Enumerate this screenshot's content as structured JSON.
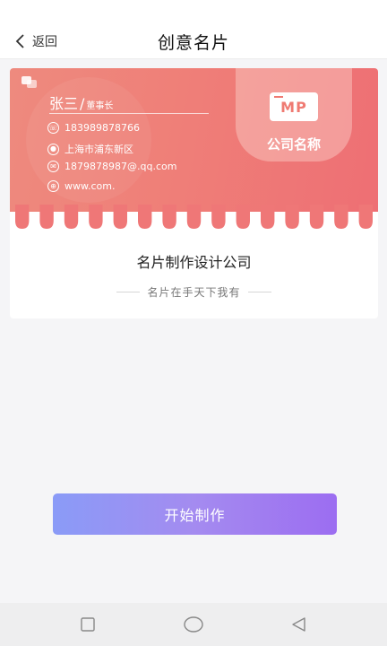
{
  "header": {
    "back_label": "返回",
    "title": "创意名片"
  },
  "card": {
    "logo_text": "MP",
    "company_short": "公司名称",
    "person_name": "张三",
    "person_title": "董事长",
    "phone": "183989878766",
    "address": "上海市浦东新区",
    "email": "1879878987@.qq.com",
    "website": "www.com.",
    "accent_color": "#ef7a72"
  },
  "template": {
    "company_full": "名片制作设计公司",
    "slogan": "名片在手天下我有"
  },
  "action": {
    "start_label": "开始制作"
  },
  "icons": {
    "back": "chevron-left-icon",
    "phone": "phone-icon",
    "location": "location-pin-icon",
    "email": "email-icon",
    "web": "globe-icon",
    "nav_recent": "square-icon",
    "nav_home": "circle-icon",
    "nav_back": "triangle-left-icon"
  }
}
